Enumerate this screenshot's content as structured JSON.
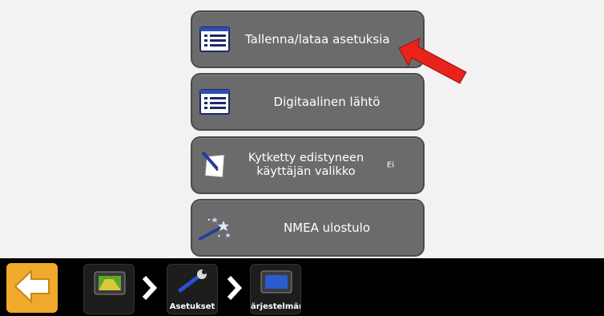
{
  "menu": {
    "items": [
      {
        "label": "Tallenna/lataa asetuksia",
        "icon": "list-icon"
      },
      {
        "label": "Digitaalinen lähtö",
        "icon": "list-icon"
      },
      {
        "label": "Kytketty edistyneen käyttäjän valikko",
        "value": "Ei",
        "icon": "notepad-pen-icon"
      },
      {
        "label": "NMEA ulostulo",
        "icon": "magic-wand-icon"
      }
    ]
  },
  "annotation": {
    "icon": "red-arrow-icon",
    "color": "#e8231a"
  },
  "bottom_bar": {
    "back_icon": "back-arrow-icon",
    "breadcrumb": [
      {
        "label": "",
        "icon": "display-unit-icon"
      },
      {
        "label": "Asetukset",
        "icon": "wrench-icon"
      },
      {
        "label": "ärjestelmän asetukset",
        "icon": "display-unit-icon"
      }
    ]
  },
  "colors": {
    "button_bg": "#6b6b6b",
    "back_button": "#f0a92a",
    "bar_bg": "#000000"
  }
}
